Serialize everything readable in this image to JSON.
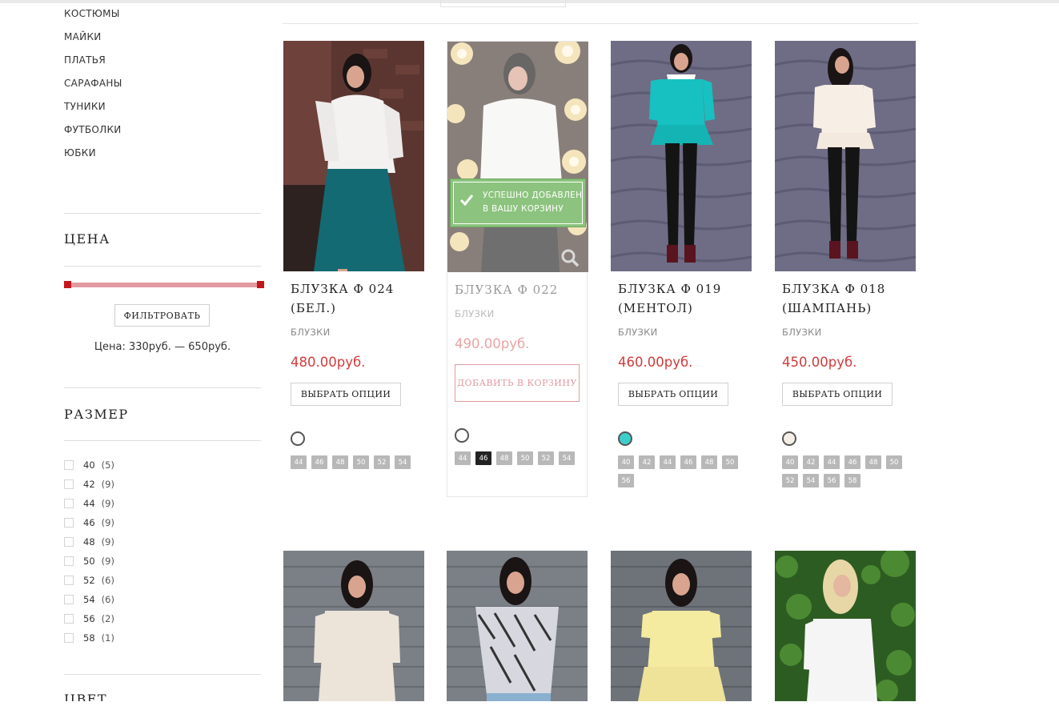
{
  "categories": [
    "КОСТЮМЫ",
    "МАЙКИ",
    "ПЛАТЬЯ",
    "САРАФАНЫ",
    "ТУНИКИ",
    "ФУТБОЛКИ",
    "ЮБКИ"
  ],
  "price_widget": {
    "title": "ЦЕНА",
    "filter_button": "ФИЛЬТРОВАТЬ",
    "range_text": "Цена: 330руб. — 650руб."
  },
  "size_widget": {
    "title": "РАЗМЕР",
    "items": [
      {
        "label": "40",
        "count": "(5)"
      },
      {
        "label": "42",
        "count": "(9)"
      },
      {
        "label": "44",
        "count": "(9)"
      },
      {
        "label": "46",
        "count": "(9)"
      },
      {
        "label": "48",
        "count": "(9)"
      },
      {
        "label": "50",
        "count": "(9)"
      },
      {
        "label": "52",
        "count": "(6)"
      },
      {
        "label": "54",
        "count": "(6)"
      },
      {
        "label": "56",
        "count": "(2)"
      },
      {
        "label": "58",
        "count": "(1)"
      }
    ]
  },
  "color_widget": {
    "title": "ЦВЕТ"
  },
  "colors": {
    "accent_red": "#d33a3a",
    "slider": "#e29aa0",
    "handle": "#c4161c",
    "toast_green": "#8cc37e",
    "swatch_mint": "#3ccfcc",
    "swatch_cream": "#f6efe8"
  },
  "products": [
    {
      "name": "БЛУЗКА Ф 024 (БЕЛ.)",
      "category": "БЛУЗКИ",
      "price": "480.00руб.",
      "button": "ВЫБРАТЬ ОПЦИИ",
      "sizes": [
        "44",
        "46",
        "48",
        "50",
        "52",
        "54"
      ]
    },
    {
      "name": "БЛУЗКА Ф 022",
      "category": "БЛУЗКИ",
      "price": "490.00руб.",
      "button": "ДОБАВИТЬ В КОРЗИНУ",
      "toast": "УСПЕШНО ДОБАВЛЕН В ВАШУ КОРЗИНУ",
      "sizes": [
        "44",
        "46",
        "48",
        "50",
        "52",
        "54"
      ],
      "selected_size": "46"
    },
    {
      "name": "БЛУЗКА Ф 019 (МЕНТОЛ)",
      "category": "БЛУЗКИ",
      "price": "460.00руб.",
      "button": "ВЫБРАТЬ ОПЦИИ",
      "sizes": [
        "40",
        "42",
        "44",
        "46",
        "48",
        "50",
        "56"
      ]
    },
    {
      "name": "БЛУЗКА Ф 018 (ШАМПАНЬ)",
      "category": "БЛУЗКИ",
      "price": "450.00руб.",
      "button": "ВЫБРАТЬ ОПЦИИ",
      "sizes": [
        "40",
        "42",
        "44",
        "46",
        "48",
        "50",
        "52",
        "54",
        "56",
        "58"
      ]
    }
  ]
}
